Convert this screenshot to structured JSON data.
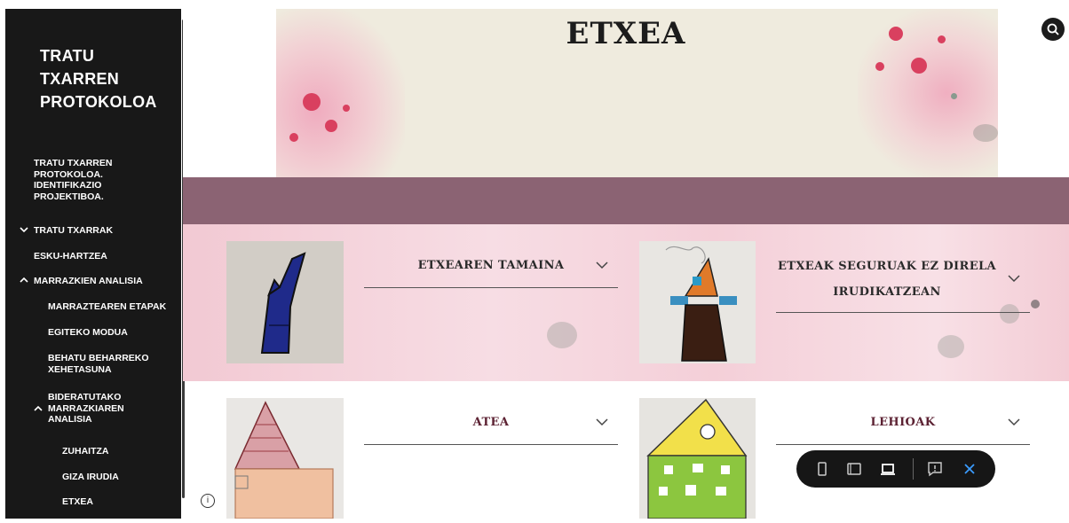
{
  "site": {
    "title": "TRATU TXARREN PROTOKOLOA",
    "title_lines": [
      "TRATU",
      "TXARREN",
      "PROTOKOLOA"
    ]
  },
  "nav": {
    "intro": [
      "TRATU TXARREN",
      "PROTOKOLOA.",
      "IDENTIFIKAZIO",
      "PROJEKTIBOA."
    ],
    "tratu_txarrak": "TRATU TXARRAK",
    "esku_hartzea": "ESKU-HARTZEA",
    "marrazkien_analisia": "MARRAZKIEN ANALISIA",
    "marrazteaaren_etapak": "MARRAZTEAREN ETAPAK",
    "egiteko_modua": "EGITEKO MODUA",
    "behatu": [
      "BEHATU BEHARREKO",
      "XEHETASUNA"
    ],
    "bideratutako": [
      "BIDERATUTAKO",
      "MARRAZKIAREN",
      "ANALISIA"
    ],
    "zuhaitza": "ZUHAITZA",
    "giza_irudia": "GIZA IRUDIA",
    "etxea": "ETXEA"
  },
  "page": {
    "title": "ETXEA"
  },
  "sections": [
    {
      "label": "ETXEAREN TAMAINA"
    },
    {
      "label_lines": [
        "ETXEAK SEGURUAK EZ DIRELA",
        "IRUDIKATZEAN"
      ]
    },
    {
      "label": "ATEA"
    },
    {
      "label": "LEHIOAK"
    }
  ],
  "icons": {
    "search": "search-icon",
    "info": "info-icon",
    "chevron": "chevron-down-icon",
    "phone": "phone-view-icon",
    "tablet": "tablet-view-icon",
    "laptop": "laptop-view-icon",
    "feedback": "feedback-icon",
    "close": "close-icon"
  },
  "colors": {
    "band": "#8b6373",
    "accent_label": "#5c2233",
    "sidebar": "#181818",
    "close": "#3b9cff"
  }
}
